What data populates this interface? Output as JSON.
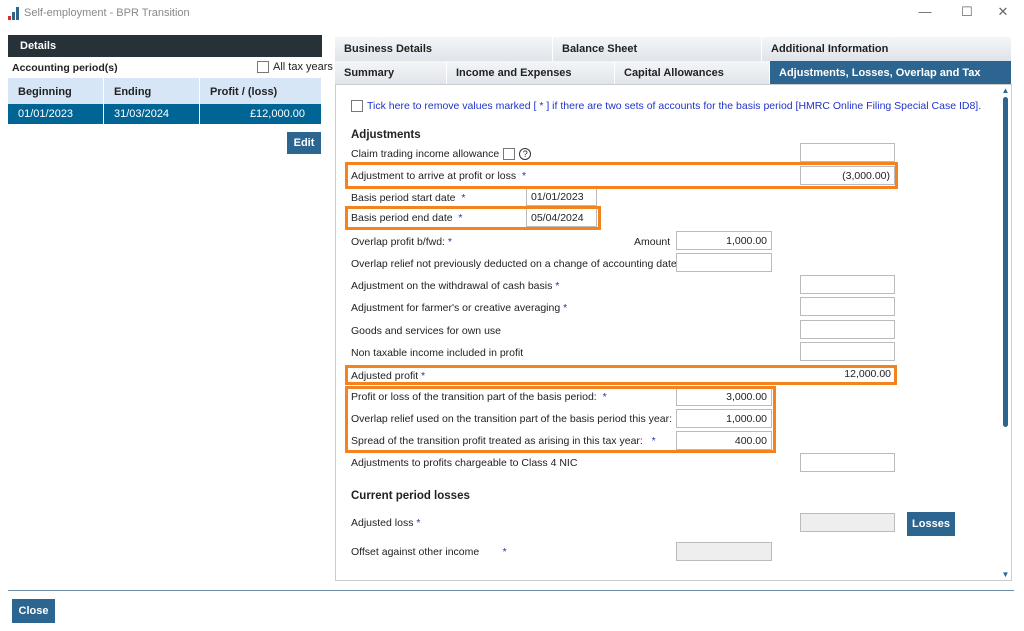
{
  "window": {
    "title": "Self-employment - BPR Transition",
    "controls": [
      "—",
      "☐",
      "✕"
    ]
  },
  "left": {
    "header": "Details",
    "accounting_label": "Accounting period(s)",
    "all_tax_years": "All tax years",
    "columns": [
      "Beginning",
      "Ending",
      "Profit / (loss)"
    ],
    "rows": [
      [
        "01/01/2023",
        "31/03/2024",
        "£12,000.00"
      ]
    ],
    "edit": "Edit"
  },
  "tabs": {
    "row1": [
      "Business Details",
      "Balance Sheet",
      "Additional Information"
    ],
    "row2": [
      "Summary",
      "Income and Expenses",
      "Capital Allowances",
      "Adjustments, Losses, Overlap and Tax"
    ],
    "active": "Adjustments, Losses, Overlap and Tax"
  },
  "form": {
    "special_case": "Tick here to remove values marked [ * ] if there are two sets of accounts for the basis period [HMRC Online Filing Special Case ID8].",
    "adjustments_h": "Adjustments",
    "claim": "Claim trading income allowance",
    "help": "?",
    "star": "*",
    "adjustment": "Adjustment to arrive at profit or loss",
    "adjustment_val": "(3,000.00)",
    "start": "Basis period start date",
    "start_val": "01/01/2023",
    "end": "Basis period end date",
    "end_val": "05/04/2024",
    "overlap": "Overlap profit b/fwd:",
    "amount": "Amount",
    "overlap_val": "1,000.00",
    "overlap_relief": "Overlap relief not previously deducted on a change of accounting date",
    "withdrawal": "Adjustment on the withdrawal of cash basis",
    "farmer": "Adjustment for farmer's or creative averaging",
    "goods": "Goods and services for own use",
    "nontax": "Non taxable income included in profit",
    "adjusted": "Adjusted profit",
    "adjusted_val": "12,000.00",
    "transition": "Profit or loss of the transition part of the basis period:",
    "transition_val": "3,000.00",
    "overlap_used": "Overlap relief used on the transition part of the basis period this year:",
    "overlap_used_val": "1,000.00",
    "spread": "Spread of the transition profit treated as arising in this tax year:",
    "spread_val": "400.00",
    "class4": "Adjustments to profits chargeable to Class 4 NIC",
    "losses_h": "Current period losses",
    "adjusted_loss": "Adjusted loss",
    "losses_btn": "Losses",
    "offset": "Offset against other income"
  },
  "close": "Close",
  "colors": {
    "accent": "#2c6690",
    "highlight": "#f5821f",
    "header": "#263238"
  }
}
